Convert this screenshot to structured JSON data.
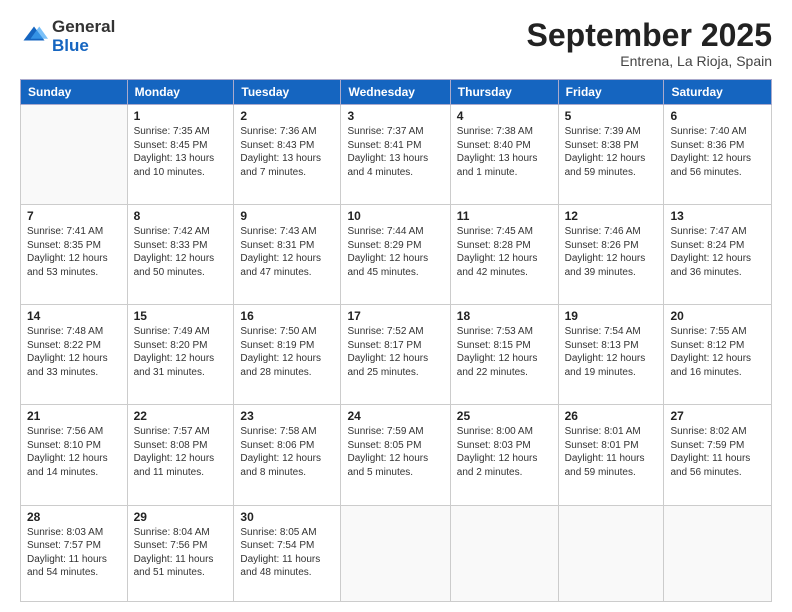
{
  "logo": {
    "general": "General",
    "blue": "Blue"
  },
  "header": {
    "month": "September 2025",
    "location": "Entrena, La Rioja, Spain"
  },
  "days_header": [
    "Sunday",
    "Monday",
    "Tuesday",
    "Wednesday",
    "Thursday",
    "Friday",
    "Saturday"
  ],
  "weeks": [
    [
      {
        "num": "",
        "info": ""
      },
      {
        "num": "1",
        "info": "Sunrise: 7:35 AM\nSunset: 8:45 PM\nDaylight: 13 hours\nand 10 minutes."
      },
      {
        "num": "2",
        "info": "Sunrise: 7:36 AM\nSunset: 8:43 PM\nDaylight: 13 hours\nand 7 minutes."
      },
      {
        "num": "3",
        "info": "Sunrise: 7:37 AM\nSunset: 8:41 PM\nDaylight: 13 hours\nand 4 minutes."
      },
      {
        "num": "4",
        "info": "Sunrise: 7:38 AM\nSunset: 8:40 PM\nDaylight: 13 hours\nand 1 minute."
      },
      {
        "num": "5",
        "info": "Sunrise: 7:39 AM\nSunset: 8:38 PM\nDaylight: 12 hours\nand 59 minutes."
      },
      {
        "num": "6",
        "info": "Sunrise: 7:40 AM\nSunset: 8:36 PM\nDaylight: 12 hours\nand 56 minutes."
      }
    ],
    [
      {
        "num": "7",
        "info": "Sunrise: 7:41 AM\nSunset: 8:35 PM\nDaylight: 12 hours\nand 53 minutes."
      },
      {
        "num": "8",
        "info": "Sunrise: 7:42 AM\nSunset: 8:33 PM\nDaylight: 12 hours\nand 50 minutes."
      },
      {
        "num": "9",
        "info": "Sunrise: 7:43 AM\nSunset: 8:31 PM\nDaylight: 12 hours\nand 47 minutes."
      },
      {
        "num": "10",
        "info": "Sunrise: 7:44 AM\nSunset: 8:29 PM\nDaylight: 12 hours\nand 45 minutes."
      },
      {
        "num": "11",
        "info": "Sunrise: 7:45 AM\nSunset: 8:28 PM\nDaylight: 12 hours\nand 42 minutes."
      },
      {
        "num": "12",
        "info": "Sunrise: 7:46 AM\nSunset: 8:26 PM\nDaylight: 12 hours\nand 39 minutes."
      },
      {
        "num": "13",
        "info": "Sunrise: 7:47 AM\nSunset: 8:24 PM\nDaylight: 12 hours\nand 36 minutes."
      }
    ],
    [
      {
        "num": "14",
        "info": "Sunrise: 7:48 AM\nSunset: 8:22 PM\nDaylight: 12 hours\nand 33 minutes."
      },
      {
        "num": "15",
        "info": "Sunrise: 7:49 AM\nSunset: 8:20 PM\nDaylight: 12 hours\nand 31 minutes."
      },
      {
        "num": "16",
        "info": "Sunrise: 7:50 AM\nSunset: 8:19 PM\nDaylight: 12 hours\nand 28 minutes."
      },
      {
        "num": "17",
        "info": "Sunrise: 7:52 AM\nSunset: 8:17 PM\nDaylight: 12 hours\nand 25 minutes."
      },
      {
        "num": "18",
        "info": "Sunrise: 7:53 AM\nSunset: 8:15 PM\nDaylight: 12 hours\nand 22 minutes."
      },
      {
        "num": "19",
        "info": "Sunrise: 7:54 AM\nSunset: 8:13 PM\nDaylight: 12 hours\nand 19 minutes."
      },
      {
        "num": "20",
        "info": "Sunrise: 7:55 AM\nSunset: 8:12 PM\nDaylight: 12 hours\nand 16 minutes."
      }
    ],
    [
      {
        "num": "21",
        "info": "Sunrise: 7:56 AM\nSunset: 8:10 PM\nDaylight: 12 hours\nand 14 minutes."
      },
      {
        "num": "22",
        "info": "Sunrise: 7:57 AM\nSunset: 8:08 PM\nDaylight: 12 hours\nand 11 minutes."
      },
      {
        "num": "23",
        "info": "Sunrise: 7:58 AM\nSunset: 8:06 PM\nDaylight: 12 hours\nand 8 minutes."
      },
      {
        "num": "24",
        "info": "Sunrise: 7:59 AM\nSunset: 8:05 PM\nDaylight: 12 hours\nand 5 minutes."
      },
      {
        "num": "25",
        "info": "Sunrise: 8:00 AM\nSunset: 8:03 PM\nDaylight: 12 hours\nand 2 minutes."
      },
      {
        "num": "26",
        "info": "Sunrise: 8:01 AM\nSunset: 8:01 PM\nDaylight: 11 hours\nand 59 minutes."
      },
      {
        "num": "27",
        "info": "Sunrise: 8:02 AM\nSunset: 7:59 PM\nDaylight: 11 hours\nand 56 minutes."
      }
    ],
    [
      {
        "num": "28",
        "info": "Sunrise: 8:03 AM\nSunset: 7:57 PM\nDaylight: 11 hours\nand 54 minutes."
      },
      {
        "num": "29",
        "info": "Sunrise: 8:04 AM\nSunset: 7:56 PM\nDaylight: 11 hours\nand 51 minutes."
      },
      {
        "num": "30",
        "info": "Sunrise: 8:05 AM\nSunset: 7:54 PM\nDaylight: 11 hours\nand 48 minutes."
      },
      {
        "num": "",
        "info": ""
      },
      {
        "num": "",
        "info": ""
      },
      {
        "num": "",
        "info": ""
      },
      {
        "num": "",
        "info": ""
      }
    ]
  ]
}
